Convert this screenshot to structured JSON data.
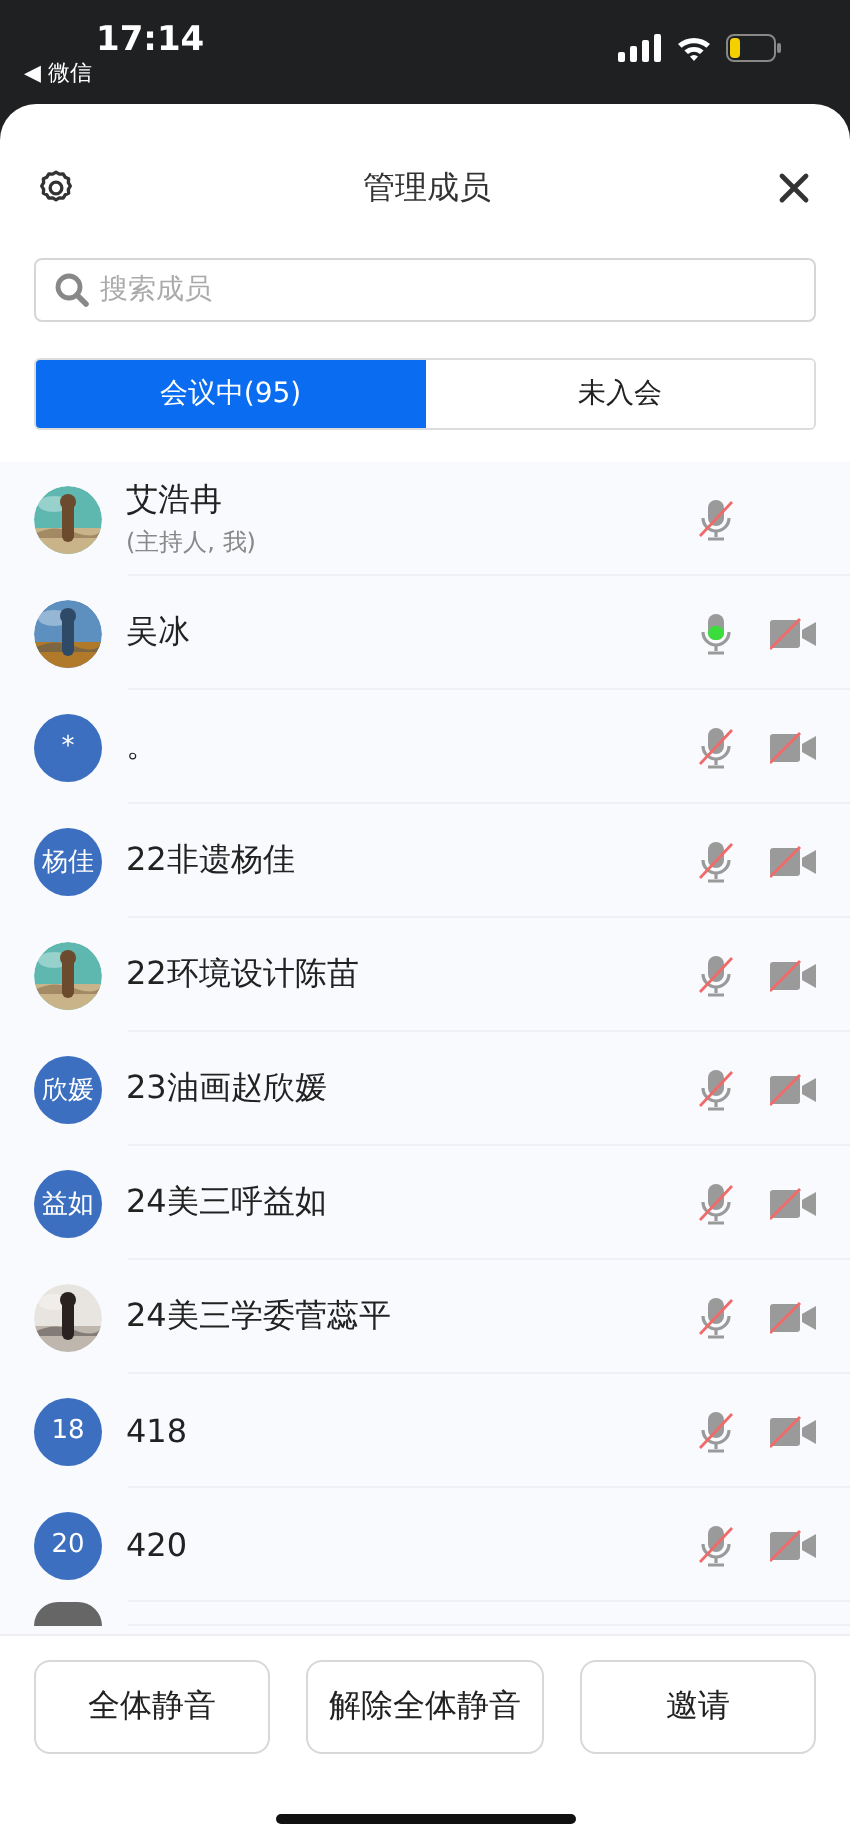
{
  "status_bar": {
    "time": "17:14",
    "back_app": "◀ 微信"
  },
  "header": {
    "title": "管理成员"
  },
  "search": {
    "placeholder": "搜索成员"
  },
  "tabs": [
    {
      "label": "会议中(95)",
      "selected": true
    },
    {
      "label": "未入会",
      "selected": false
    }
  ],
  "members": [
    {
      "name": "艾浩冉",
      "role": "(主持人, 我)",
      "mic_muted": true,
      "camera_icon": false
    },
    {
      "name": "吴冰",
      "mic_muted": false,
      "camera_icon": true
    },
    {
      "name": "。",
      "avatar": {
        "kind": "initials",
        "text": "*"
      },
      "mic_muted": true,
      "camera_icon": true
    },
    {
      "name": "22非遗杨佳",
      "avatar": {
        "kind": "initials",
        "text": "杨佳"
      },
      "mic_muted": true,
      "camera_icon": true
    },
    {
      "name": "22环境设计陈苗",
      "mic_muted": true,
      "camera_icon": true
    },
    {
      "name": "23油画赵欣媛",
      "avatar": {
        "kind": "initials",
        "text": "欣媛"
      },
      "mic_muted": true,
      "camera_icon": true
    },
    {
      "name": "24美三呼益如",
      "avatar": {
        "kind": "initials",
        "text": "益如"
      },
      "mic_muted": true,
      "camera_icon": true
    },
    {
      "name": "24美三学委菅蕊平",
      "mic_muted": true,
      "camera_icon": true
    },
    {
      "name": "418",
      "avatar": {
        "kind": "initials",
        "text": "18"
      },
      "mic_muted": true,
      "camera_icon": true
    },
    {
      "name": "420",
      "avatar": {
        "kind": "initials",
        "text": "20"
      },
      "mic_muted": true,
      "camera_icon": true
    }
  ],
  "buttons": [
    "全体静音",
    "解除全体静音",
    "邀请"
  ]
}
